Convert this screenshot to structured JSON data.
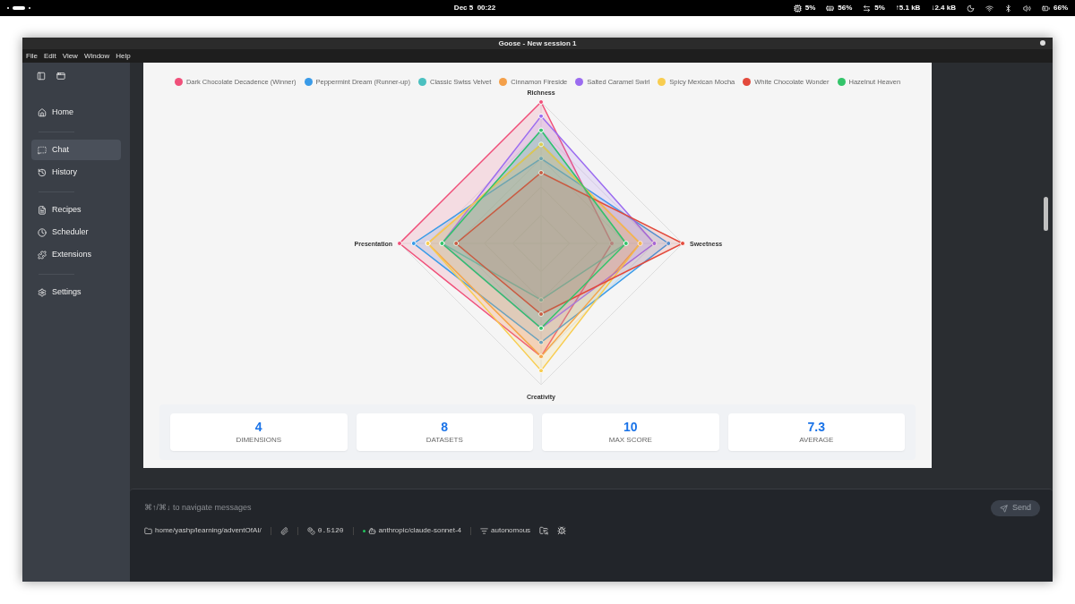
{
  "top_bar": {
    "clock": "Dec 5  00:22",
    "indicators": [
      {
        "kind": "cpu",
        "text": "5%"
      },
      {
        "kind": "memory",
        "text": "56%"
      },
      {
        "kind": "swap",
        "text": "5%"
      },
      {
        "kind": "up",
        "text": "↑5.1 kB"
      },
      {
        "kind": "down",
        "text": "↓2.4 kB"
      }
    ],
    "battery": "66%"
  },
  "window": {
    "title": "Goose - New session 1"
  },
  "menu": [
    "File",
    "Edit",
    "View",
    "Window",
    "Help"
  ],
  "sidebar": {
    "items": [
      {
        "label": "Home",
        "selected": false
      },
      {
        "label": "Chat",
        "selected": true
      },
      {
        "label": "History",
        "selected": false
      },
      {
        "label": "Recipes",
        "selected": false
      },
      {
        "label": "Scheduler",
        "selected": false
      },
      {
        "label": "Extensions",
        "selected": false
      },
      {
        "label": "Settings",
        "selected": false
      }
    ]
  },
  "chart": {
    "legend": [
      {
        "name": "Dark Chocolate Decadence (Winner)",
        "color": "#f0507a"
      },
      {
        "name": "Peppermint Dream (Runner-up)",
        "color": "#3a9be8"
      },
      {
        "name": "Classic Swiss Velvet",
        "color": "#4bc0c0"
      },
      {
        "name": "Cinnamon Fireside",
        "color": "#f4a04a"
      },
      {
        "name": "Salted Caramel Swirl",
        "color": "#9b6cf0"
      },
      {
        "name": "Spicy Mexican Mocha",
        "color": "#f8cd50"
      },
      {
        "name": "White Chocolate Wonder",
        "color": "#e34a3c"
      },
      {
        "name": "Hazelnut Heaven",
        "color": "#33c46a"
      }
    ],
    "axes": [
      "Richness",
      "Sweetness",
      "Creativity",
      "Presentation"
    ]
  },
  "stats": [
    {
      "value": "4",
      "label": "DIMENSIONS"
    },
    {
      "value": "8",
      "label": "DATASETS"
    },
    {
      "value": "10",
      "label": "MAX SCORE"
    },
    {
      "value": "7.3",
      "label": "AVERAGE"
    }
  ],
  "composer": {
    "placeholder": "⌘↑/⌘↓ to navigate messages",
    "send": "Send"
  },
  "footer": {
    "path": "home/yashp/learning/adventOfAI/",
    "cost": "0.5120",
    "model": "anthropic/claude-sonnet-4",
    "mode": "autonomous"
  }
}
